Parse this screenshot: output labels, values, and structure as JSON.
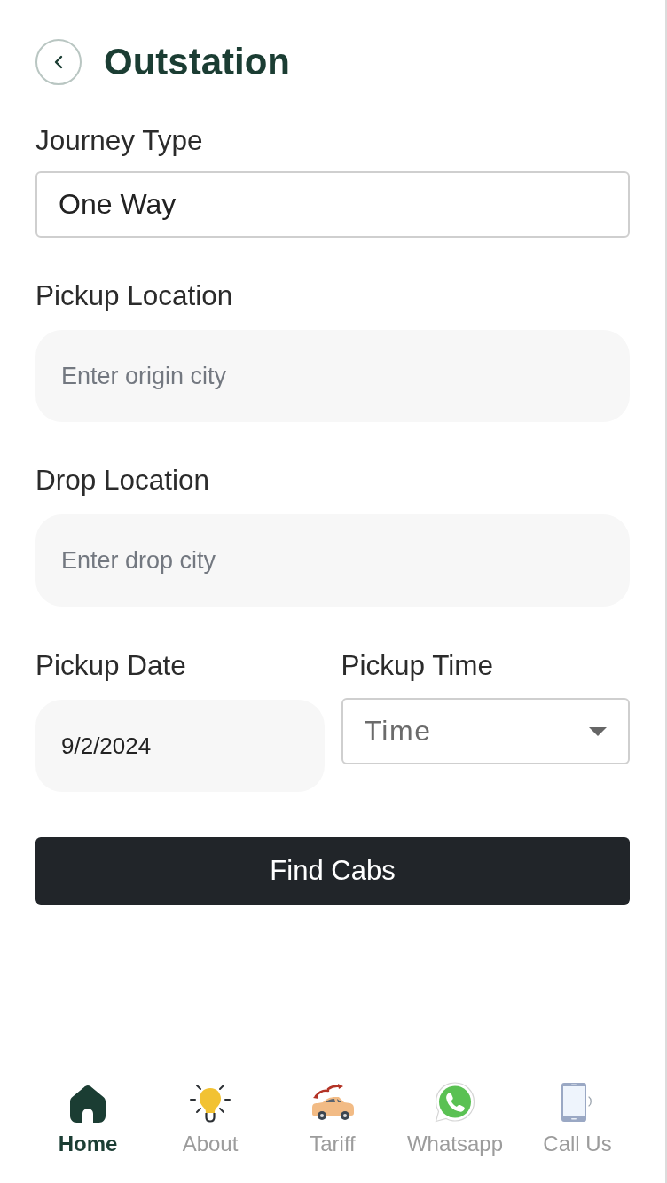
{
  "header": {
    "title": "Outstation"
  },
  "fields": [
    {
      "kind": "select",
      "label": "Journey Type",
      "value": "One Way"
    },
    {
      "kind": "text",
      "label": "Pickup Location",
      "placeholder": "Enter origin city"
    },
    {
      "kind": "text",
      "label": "Drop Location",
      "placeholder": "Enter drop city"
    }
  ],
  "schedule": [
    {
      "kind": "date",
      "label": "Pickup Date",
      "value": "9/2/2024"
    },
    {
      "kind": "dropdown",
      "label": "Pickup Time",
      "placeholder": "Time"
    }
  ],
  "submit_button": {
    "label": "Find Cabs"
  },
  "bottom_nav": [
    {
      "label": "Home",
      "selected": true
    },
    {
      "label": "About",
      "selected": false
    },
    {
      "label": "Tariff",
      "selected": false
    },
    {
      "label": "Whatsapp",
      "selected": false
    },
    {
      "label": "Call Us",
      "selected": false
    }
  ]
}
